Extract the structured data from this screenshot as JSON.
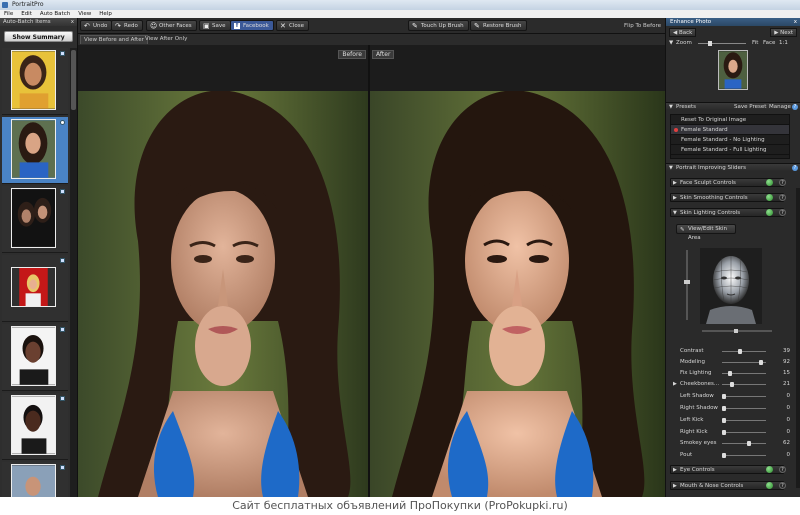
{
  "window": {
    "title": "PortraitPro"
  },
  "menu": [
    "File",
    "Edit",
    "Auto Batch",
    "View",
    "Help"
  ],
  "left_panel": {
    "header": "Auto-Batch Items",
    "close": "x",
    "show_summary": "Show Summary"
  },
  "toolbar": {
    "undo": "Undo",
    "redo": "Redo",
    "other_faces": "Other Faces",
    "save": "Save",
    "facebook": "Facebook",
    "close": "Close",
    "touch_up": "Touch Up Brush",
    "restore": "Restore Brush"
  },
  "view_tabs": {
    "before_after": "View Before and After",
    "after_only": "View After Only",
    "flip": "Flip To Before"
  },
  "panes": {
    "before": "Before",
    "after": "After"
  },
  "right_panel": {
    "enhance_title": "Enhance Photo",
    "back": "Back",
    "next": "Next",
    "zoom": "Zoom",
    "fit": "Fit",
    "face": "Face",
    "one_to_one": "1:1",
    "presets": {
      "title": "Presets",
      "save": "Save Preset",
      "manage": "Manage",
      "items": [
        "Reset To Original Image",
        "Female Standard",
        "Female Standard - No Lighting",
        "Female Standard - Full Lighting"
      ]
    },
    "sliders_title": "Portrait Improving Sliders",
    "controls": {
      "face_sculpt": "Face Sculpt Controls",
      "skin_smoothing": "Skin Smoothing Controls",
      "skin_lighting": "Skin Lighting Controls",
      "view_skin": "View/Edit Skin Area",
      "eye": "Eye Controls",
      "mouth_nose": "Mouth & Nose Controls"
    },
    "sliders": [
      {
        "label": "Contrast",
        "value": 39
      },
      {
        "label": "Modeling",
        "value": 92
      },
      {
        "label": "Fix Lighting",
        "value": 15
      },
      {
        "label": "Cheekbones...",
        "value": 21
      },
      {
        "label": "Left Shadow",
        "value": 0
      },
      {
        "label": "Right Shadow",
        "value": 0
      },
      {
        "label": "Left Kick",
        "value": 0
      },
      {
        "label": "Right Kick",
        "value": 0
      },
      {
        "label": "Smokey eyes",
        "value": 62
      },
      {
        "label": "Pout",
        "value": 0
      }
    ]
  },
  "footer": "Сайт бесплатных объявлений ПроПокупки (ProPokupki.ru)"
}
